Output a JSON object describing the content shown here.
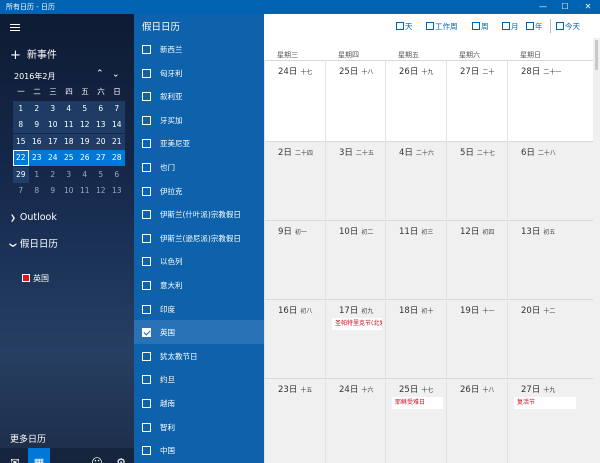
{
  "window": {
    "title": "所有日历 - 日历",
    "controls": [
      "—",
      "☐",
      "✕"
    ]
  },
  "sidebar": {
    "new_event": "新事件",
    "month_label": "2016年2月",
    "weekday_headers": [
      "一",
      "二",
      "三",
      "四",
      "五",
      "六",
      "日"
    ],
    "weeks": [
      [
        {
          "d": "1"
        },
        {
          "d": "2"
        },
        {
          "d": "3"
        },
        {
          "d": "4"
        },
        {
          "d": "5"
        },
        {
          "d": "6"
        },
        {
          "d": "7"
        }
      ],
      [
        {
          "d": "8"
        },
        {
          "d": "9"
        },
        {
          "d": "10"
        },
        {
          "d": "11"
        },
        {
          "d": "12"
        },
        {
          "d": "13"
        },
        {
          "d": "14"
        }
      ],
      [
        {
          "d": "15"
        },
        {
          "d": "16"
        },
        {
          "d": "17"
        },
        {
          "d": "18"
        },
        {
          "d": "19"
        },
        {
          "d": "20"
        },
        {
          "d": "21"
        }
      ],
      [
        {
          "d": "22"
        },
        {
          "d": "23"
        },
        {
          "d": "24"
        },
        {
          "d": "25"
        },
        {
          "d": "26"
        },
        {
          "d": "27"
        },
        {
          "d": "28"
        }
      ],
      [
        {
          "d": "29"
        },
        {
          "d": "1",
          "o": true
        },
        {
          "d": "2",
          "o": true
        },
        {
          "d": "3",
          "o": true
        },
        {
          "d": "4",
          "o": true
        },
        {
          "d": "5",
          "o": true
        },
        {
          "d": "6",
          "o": true
        }
      ],
      [
        {
          "d": "7",
          "o": true
        },
        {
          "d": "8",
          "o": true
        },
        {
          "d": "9",
          "o": true
        },
        {
          "d": "10",
          "o": true
        },
        {
          "d": "11",
          "o": true
        },
        {
          "d": "12",
          "o": true
        },
        {
          "d": "13",
          "o": true
        }
      ]
    ],
    "accounts": [
      {
        "label": "Outlook",
        "expanded": false
      },
      {
        "label": "假日日历",
        "expanded": true
      }
    ],
    "holiday_calendar": "英国",
    "more_calendars": "更多日历"
  },
  "holiday_list": {
    "title": "假日日历",
    "items": [
      {
        "label": "新西兰",
        "checked": false
      },
      {
        "label": "匈牙利",
        "checked": false
      },
      {
        "label": "叙利亚",
        "checked": false
      },
      {
        "label": "牙买加",
        "checked": false
      },
      {
        "label": "亚美尼亚",
        "checked": false
      },
      {
        "label": "也门",
        "checked": false
      },
      {
        "label": "伊拉克",
        "checked": false
      },
      {
        "label": "伊斯兰(什叶派)宗教假日",
        "checked": false
      },
      {
        "label": "伊斯兰(逊尼派)宗教假日",
        "checked": false
      },
      {
        "label": "以色列",
        "checked": false
      },
      {
        "label": "意大利",
        "checked": false
      },
      {
        "label": "印度",
        "checked": false
      },
      {
        "label": "英国",
        "checked": true
      },
      {
        "label": "犹太教节日",
        "checked": false
      },
      {
        "label": "约旦",
        "checked": false
      },
      {
        "label": "越南",
        "checked": false
      },
      {
        "label": "智利",
        "checked": false
      },
      {
        "label": "中国",
        "checked": false
      }
    ]
  },
  "toolbar": {
    "day": "天",
    "work_week": "工作周",
    "week": "周",
    "month": "月",
    "year": "年",
    "today": "今天"
  },
  "month_view": {
    "columns": [
      "星期三",
      "星期四",
      "星期五",
      "星期六",
      "星期日"
    ],
    "weeks": [
      [
        {
          "d": "24日",
          "l": "十七"
        },
        {
          "d": "25日",
          "l": "十八"
        },
        {
          "d": "26日",
          "l": "十九"
        },
        {
          "d": "27日",
          "l": "二十"
        },
        {
          "d": "28日",
          "l": "二十一"
        }
      ],
      [
        {
          "d": "2日",
          "l": "二十四"
        },
        {
          "d": "3日",
          "l": "二十五"
        },
        {
          "d": "4日",
          "l": "二十六"
        },
        {
          "d": "5日",
          "l": "二十七"
        },
        {
          "d": "6日",
          "l": "二十八"
        }
      ],
      [
        {
          "d": "9日",
          "l": "初一"
        },
        {
          "d": "10日",
          "l": "初二"
        },
        {
          "d": "11日",
          "l": "初三"
        },
        {
          "d": "12日",
          "l": "初四"
        },
        {
          "d": "13日",
          "l": "初五"
        }
      ],
      [
        {
          "d": "16日",
          "l": "初八"
        },
        {
          "d": "17日",
          "l": "初九",
          "ev": "圣帕特里克节(北爱"
        },
        {
          "d": "18日",
          "l": "初十"
        },
        {
          "d": "19日",
          "l": "十一"
        },
        {
          "d": "20日",
          "l": "十二"
        }
      ],
      [
        {
          "d": "23日",
          "l": "十五"
        },
        {
          "d": "24日",
          "l": "十六"
        },
        {
          "d": "25日",
          "l": "十七",
          "ev": "耶稣受难日"
        },
        {
          "d": "26日",
          "l": "十八"
        },
        {
          "d": "27日",
          "l": "十九",
          "ev": "复活节"
        }
      ]
    ]
  },
  "colors": {
    "accent": "#0078d7",
    "title_bar": "#0063b1",
    "holiday_panel": "#0d62ab",
    "event_text": "#c50f1f"
  }
}
